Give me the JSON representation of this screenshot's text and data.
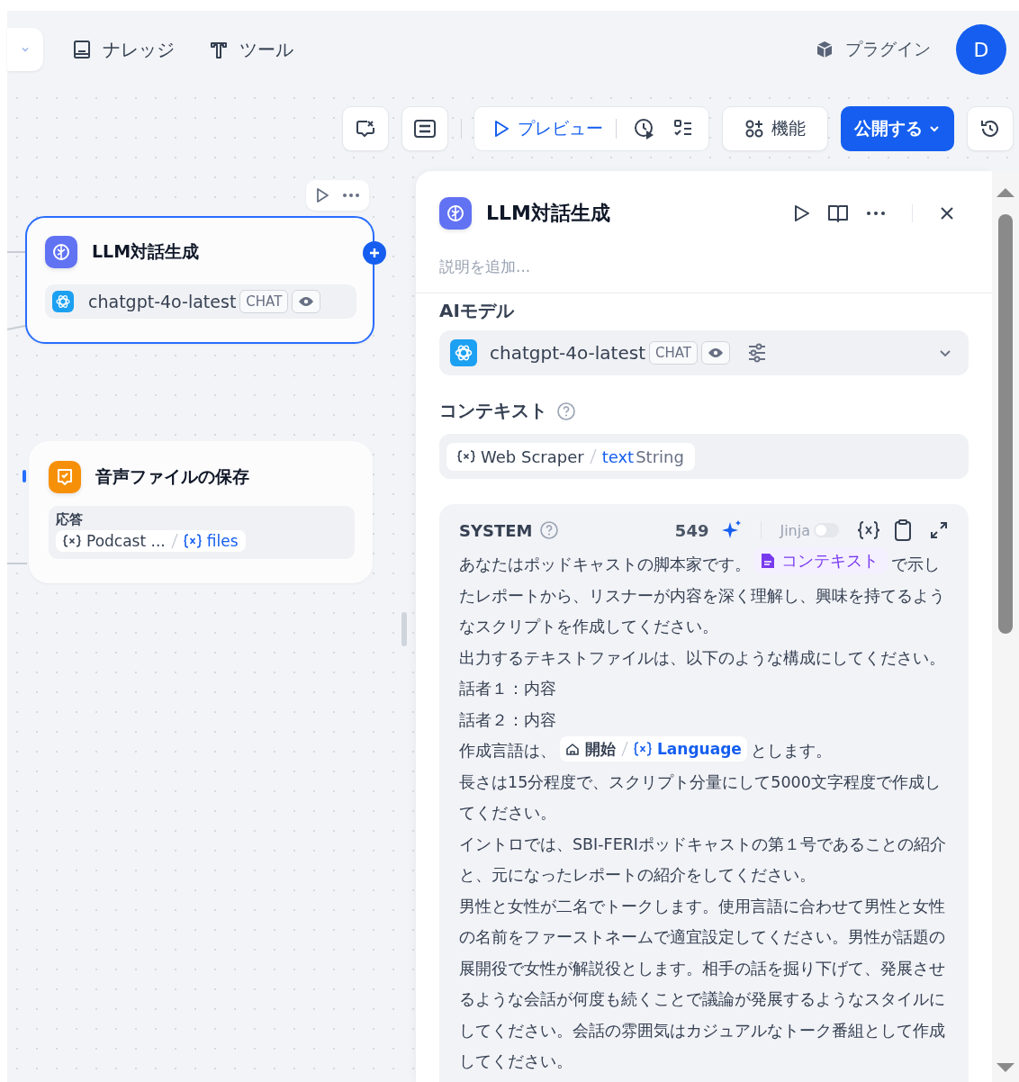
{
  "top_nav": {
    "items": [
      {
        "kind": "knowledge",
        "label": "ナレッジ"
      },
      {
        "kind": "tools",
        "label": "ツール"
      }
    ],
    "plugin": "プラグイン",
    "avatar": "D"
  },
  "toolbar": {
    "preview": "プレビュー",
    "features": "機能",
    "publish": "公開する"
  },
  "nodes": [
    {
      "kind": "llm",
      "title": "LLM対話生成",
      "selected": true,
      "model": "chatgpt-4o-latest",
      "mode": "CHAT"
    },
    {
      "kind": "save",
      "title": "音声ファイルの保存",
      "selected": false,
      "field_label": "応答",
      "var_node": "Podcast ...",
      "var_name": "files"
    }
  ],
  "panel": {
    "title": "LLM対話生成",
    "description_placeholder": "説明を追加...",
    "model_label": "AIモデル",
    "model": "chatgpt-4o-latest",
    "mode": "CHAT",
    "context_label": "コンテキスト",
    "context_var": {
      "node": "Web Scraper",
      "name": "text",
      "type": "String"
    },
    "prompt": {
      "role": "SYSTEM",
      "count": "549",
      "jinja_label": "Jinja",
      "jinja_on": false,
      "paragraphs": [
        [
          {
            "kind": "text",
            "text": "あなたはポッドキャストの脚本家です。"
          },
          {
            "kind": "context",
            "label": "コンテキスト"
          },
          {
            "kind": "text",
            "text": "で示したレポートから、リスナーが内容を深く理解し、興味を持てるようなスクリプトを作成してください。"
          }
        ],
        [
          {
            "kind": "text",
            "text": "出力するテキストファイルは、以下のような構成にしてください。"
          }
        ],
        [
          {
            "kind": "text",
            "text": "話者１：内容"
          }
        ],
        [
          {
            "kind": "text",
            "text": "話者２：内容"
          }
        ],
        [
          {
            "kind": "text",
            "text": "作成言語は、"
          },
          {
            "kind": "var",
            "node": "開始",
            "name": "Language"
          },
          {
            "kind": "text",
            "text": "とします。"
          }
        ],
        [
          {
            "kind": "text",
            "text": "長さは15分程度で、スクリプト分量にして5000文字程度で作成してください。"
          }
        ],
        [
          {
            "kind": "text",
            "text": "イントロでは、SBI-FERIポッドキャストの第１号であることの紹介と、元になったレポートの紹介をしてください。"
          }
        ],
        [
          {
            "kind": "text",
            "text": "男性と女性が二名でトークします。使用言語に合わせて男性と女性の名前をファーストネームで適宜設定してください。男性が話題の展開役で女性が解説役とします。相手の話を掘り下げて、発展させるような会話が何度も続くことで議論が発展するようなスタイルにしてください。会話の雰囲気はカジュアルなトーク番組として作成してください。"
          }
        ]
      ]
    }
  }
}
